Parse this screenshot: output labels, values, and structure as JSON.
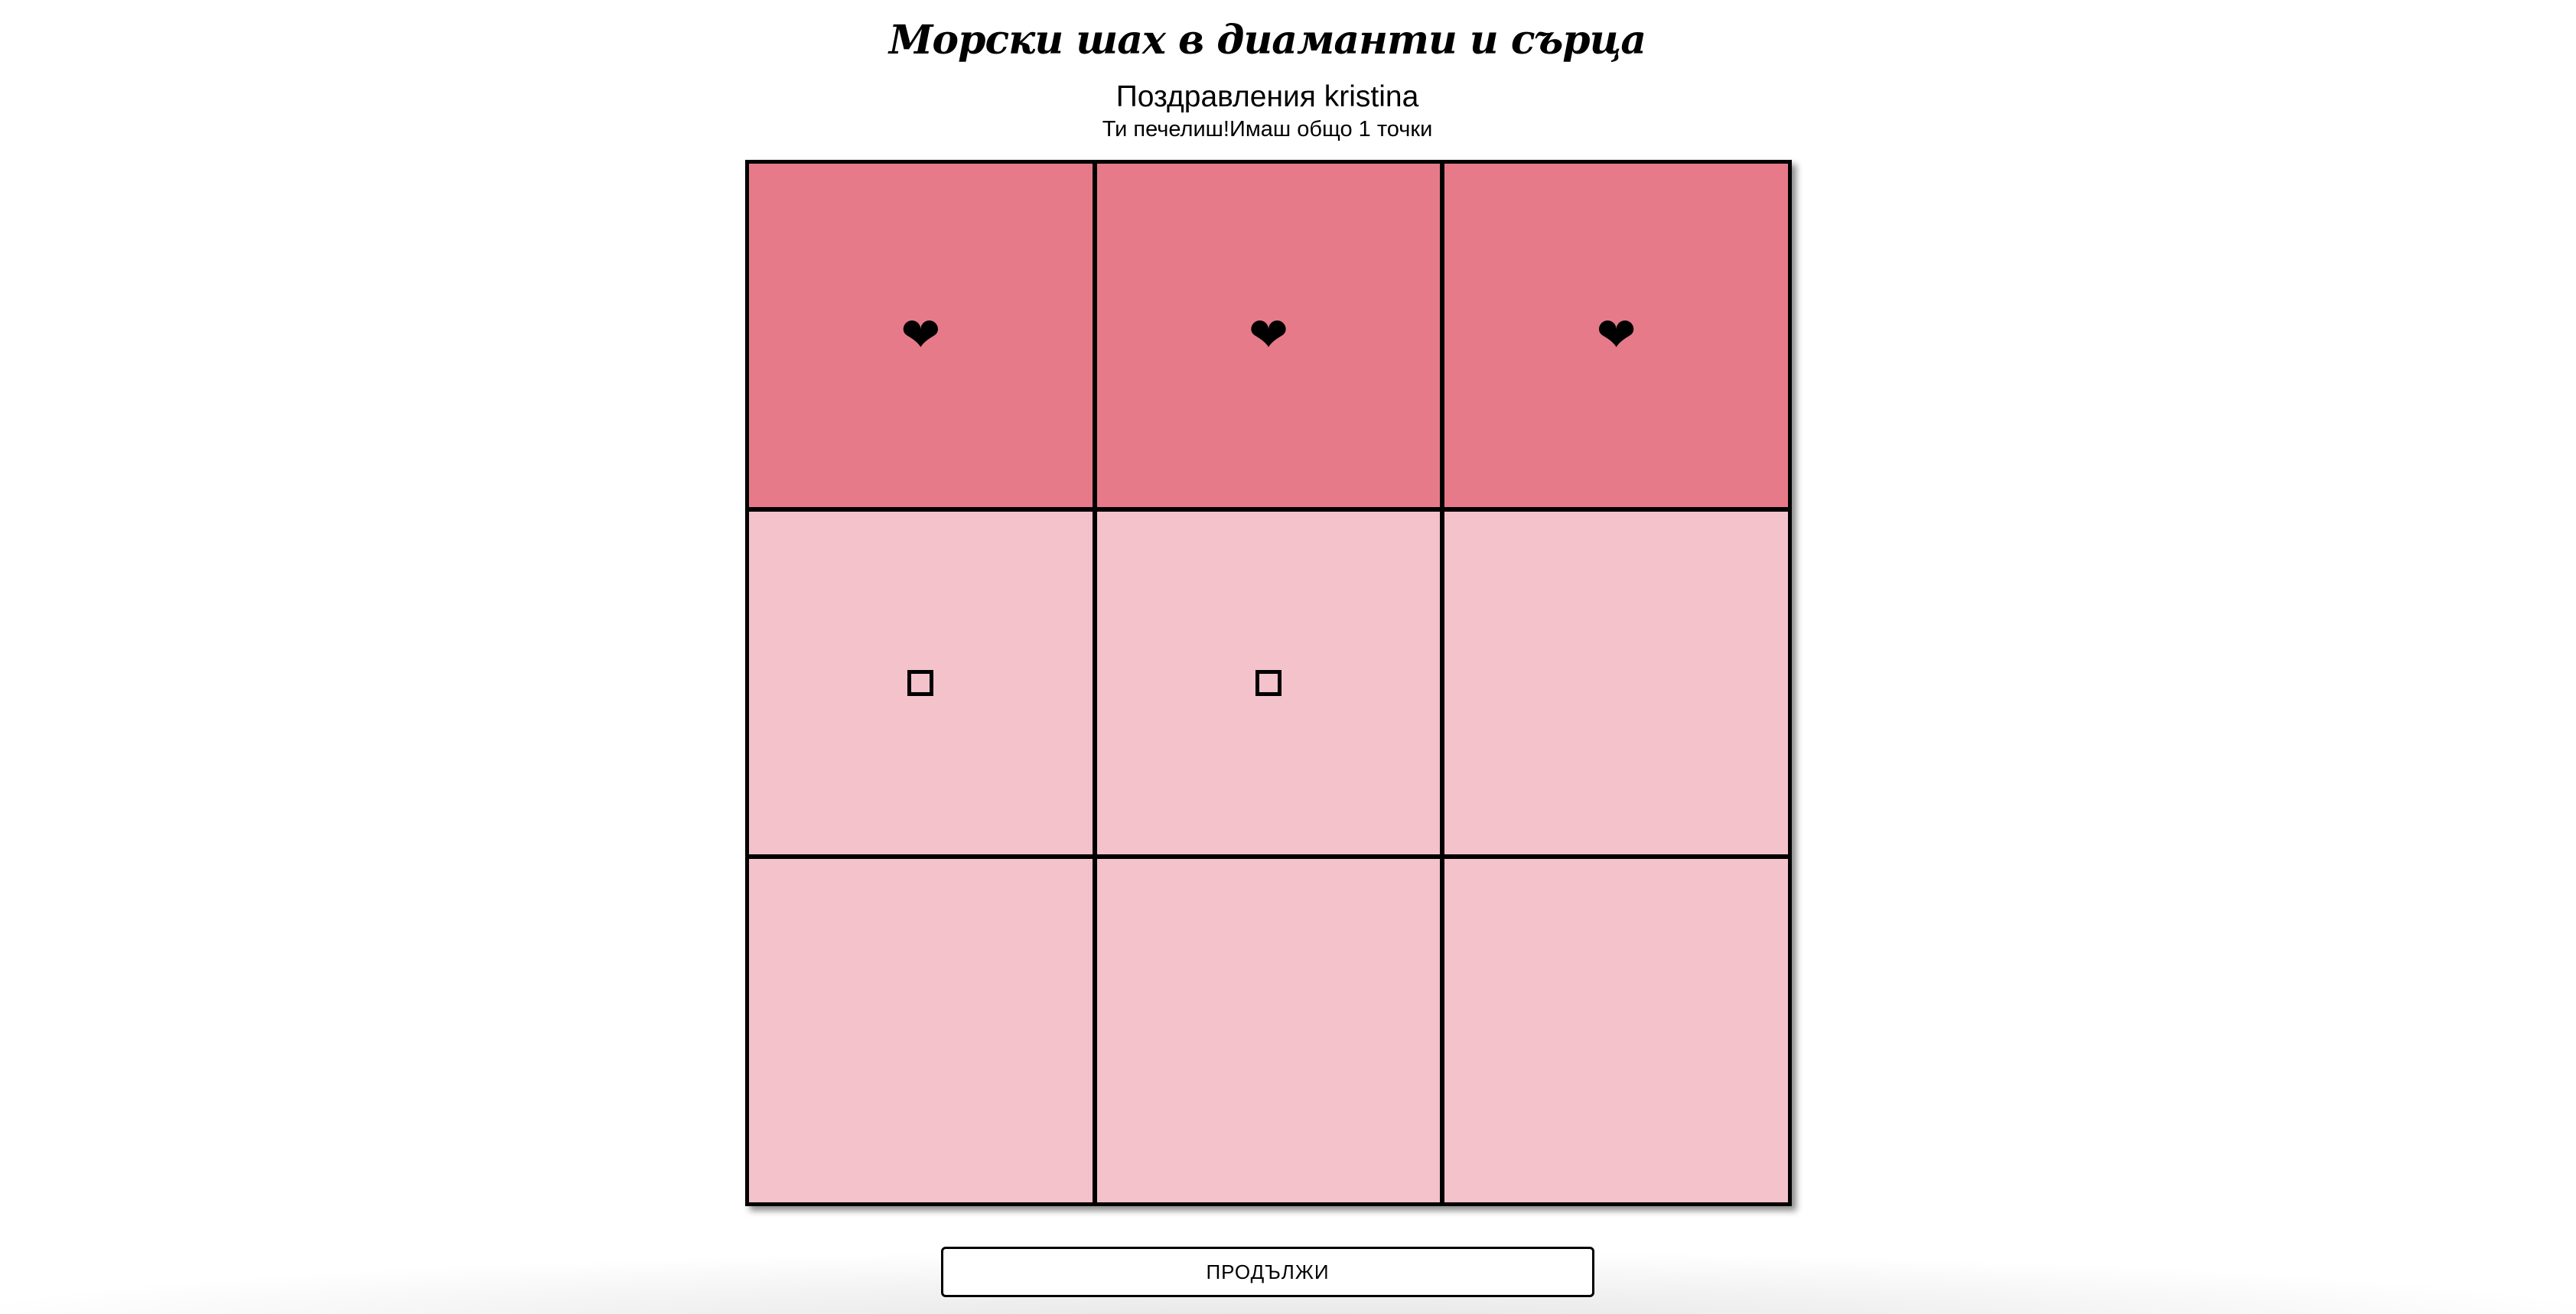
{
  "title": "Морски шах в диаманти и сърца",
  "congrats": "Поздравления kristina",
  "result_line": "Ти печелиш!Имаш общо 1 точки",
  "board": {
    "cells": [
      {
        "mark": "❤",
        "icon": "heart-icon",
        "winning": true
      },
      {
        "mark": "❤",
        "icon": "heart-icon",
        "winning": true
      },
      {
        "mark": "❤",
        "icon": "heart-icon",
        "winning": true
      },
      {
        "mark": "□",
        "icon": "diamond-square-icon",
        "winning": false
      },
      {
        "mark": "□",
        "icon": "diamond-square-icon",
        "winning": false
      },
      {
        "mark": "",
        "icon": "",
        "winning": false
      },
      {
        "mark": "",
        "icon": "",
        "winning": false
      },
      {
        "mark": "",
        "icon": "",
        "winning": false
      },
      {
        "mark": "",
        "icon": "",
        "winning": false
      }
    ]
  },
  "colors": {
    "win_cell": "#e67a89",
    "cell": "#f4c2cb",
    "grid": "#000000"
  },
  "continue_button": {
    "label": "ПРОДЪЛЖИ"
  }
}
